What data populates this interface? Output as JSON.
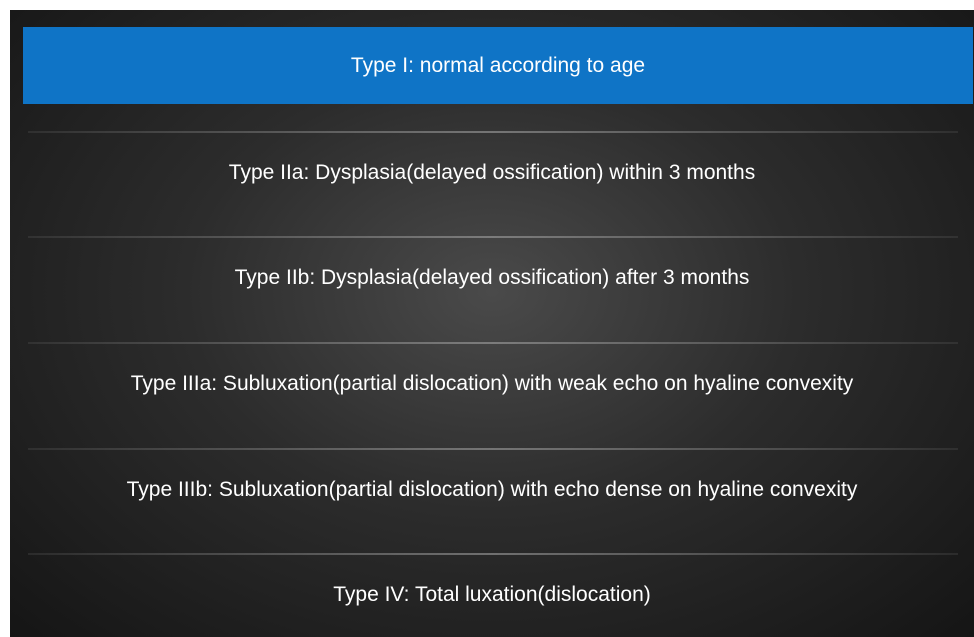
{
  "menu": {
    "items": [
      {
        "label": "Type I: normal according to age",
        "selected": true
      },
      {
        "label": "Type IIa: Dysplasia(delayed ossification) within 3 months",
        "selected": false
      },
      {
        "label": "Type IIb: Dysplasia(delayed ossification) after 3 months",
        "selected": false
      },
      {
        "label": "Type IIIa: Subluxation(partial dislocation) with weak echo on hyaline convexity",
        "selected": false
      },
      {
        "label": "Type IIIb: Subluxation(partial dislocation) with echo dense on hyaline convexity",
        "selected": false
      },
      {
        "label": "Type IV: Total luxation(dislocation)",
        "selected": false
      }
    ]
  },
  "colors": {
    "selected_background": "#0f74c6",
    "text": "#ffffff",
    "panel_background": "#2c2c2c"
  }
}
